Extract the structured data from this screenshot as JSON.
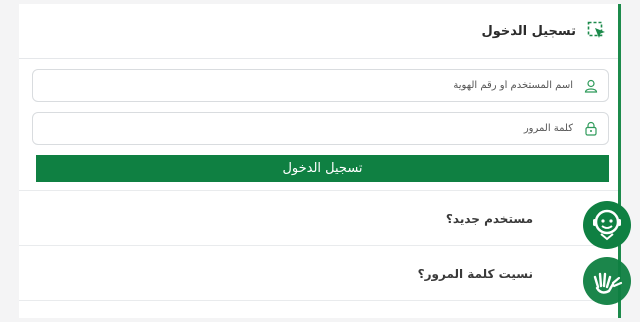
{
  "login": {
    "title": "تسجيل الدخول",
    "username_placeholder": "اسم المستخدم أو رقم الهوية",
    "password_placeholder": "كلمة المرور",
    "button_label": "تسجيل الدخول"
  },
  "links": {
    "new_user": "مستخدم جديد؟",
    "forgot_password": "نسيت كلمة المرور؟"
  },
  "colors": {
    "accent": "#0f8042",
    "header_icon": "#1c8a4b"
  },
  "icons": {
    "header": "login-cursor-icon",
    "username": "user-icon",
    "password": "lock-icon",
    "assistant": "chatbot-icon",
    "accessibility": "sign-language-icon"
  }
}
